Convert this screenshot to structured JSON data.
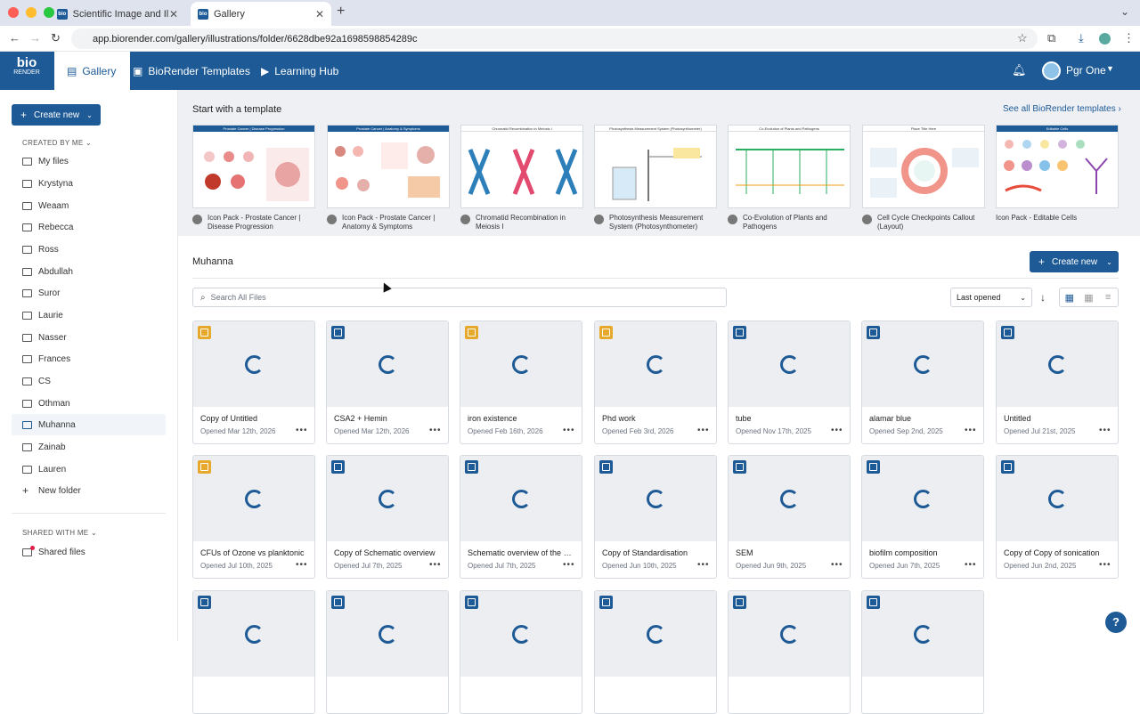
{
  "browser": {
    "tabs": [
      {
        "label": "Scientific Image and Illustrati"
      },
      {
        "label": "Gallery"
      }
    ],
    "url": "app.biorender.com/gallery/illustrations/folder/6628dbe92a1698598854289c"
  },
  "topnav": {
    "logo_top": "bio",
    "logo_bottom": "RENDER",
    "items": [
      {
        "label": "Gallery"
      },
      {
        "label": "BioRender Templates"
      },
      {
        "label": "Learning Hub"
      }
    ],
    "user": "Pgr One"
  },
  "sidebar": {
    "create_label": "Create new",
    "created_section": "CREATED BY ME",
    "items": [
      {
        "label": "My files"
      },
      {
        "label": "Krystyna"
      },
      {
        "label": "Weaam"
      },
      {
        "label": "Rebecca"
      },
      {
        "label": "Ross"
      },
      {
        "label": "Abdullah"
      },
      {
        "label": "Suror"
      },
      {
        "label": "Laurie"
      },
      {
        "label": "Nasser"
      },
      {
        "label": "Frances"
      },
      {
        "label": "CS"
      },
      {
        "label": "Othman"
      },
      {
        "label": "Muhanna"
      },
      {
        "label": "Zainab"
      },
      {
        "label": "Lauren"
      }
    ],
    "new_folder": "New folder",
    "shared_section": "SHARED WITH ME",
    "shared_files": "Shared files"
  },
  "templates": {
    "heading": "Start with a template",
    "see_all": "See all BioRender templates",
    "items": [
      {
        "caption": "Icon Pack - Prostate Cancer | Disease Progression",
        "thumb_title": "Prostate Cancer | Disease Progression"
      },
      {
        "caption": "Icon Pack - Prostate Cancer | Anatomy & Symptoms",
        "thumb_title": "Prostate Cancer | Anatomy & Symptoms"
      },
      {
        "caption": "Chromatid Recombination in Meiosis I",
        "thumb_title": "Chromatid Recombination in Meiosis I"
      },
      {
        "caption": "Photosynthesis Measurement System (Photosynthometer)",
        "thumb_title": "Photosynthesis Measurement System (Photosynthometer)"
      },
      {
        "caption": "Co-Evolution of Plants and Pathogens",
        "thumb_title": "Co-Evolution of Plants and Pathogens"
      },
      {
        "caption": "Cell Cycle Checkpoints Callout (Layout)",
        "thumb_title": "Place Title Here"
      },
      {
        "caption": "Icon Pack - Editable Cells",
        "thumb_title": "Editable Cells"
      }
    ]
  },
  "folder": {
    "title": "Muhanna",
    "create_label": "Create new",
    "search_placeholder": "Search All Files",
    "sort": "Last opened",
    "colors": {
      "brand": "#1d5a96",
      "badge_blue": "#1d5a96",
      "badge_orange": "#e7a92b"
    },
    "files": [
      {
        "title": "Copy of Untitled",
        "opened": "Opened Mar 12th, 2026",
        "badge": "orange"
      },
      {
        "title": "CSA2 + Hemin",
        "opened": "Opened Mar 12th, 2026",
        "badge": "blue"
      },
      {
        "title": "iron existence",
        "opened": "Opened Feb 16th, 2026",
        "badge": "orange"
      },
      {
        "title": "Phd work",
        "opened": "Opened Feb 3rd, 2026",
        "badge": "orange"
      },
      {
        "title": "tube",
        "opened": "Opened Nov 17th, 2025",
        "badge": "blue"
      },
      {
        "title": "alamar blue",
        "opened": "Opened Sep 2nd, 2025",
        "badge": "blue"
      },
      {
        "title": "Untitled",
        "opened": "Opened Jul 21st, 2025",
        "badge": "blue"
      },
      {
        "title": "CFUs of Ozone vs planktonic",
        "opened": "Opened Jul 10th, 2025",
        "badge": "orange"
      },
      {
        "title": "Copy of Schematic overview",
        "opened": "Opened Jul 7th, 2025",
        "badge": "blue"
      },
      {
        "title": "Schematic overview of the biofilm",
        "opened": "Opened Jul 7th, 2025",
        "badge": "blue"
      },
      {
        "title": "Copy of Standardisation",
        "opened": "Opened Jun 10th, 2025",
        "badge": "blue"
      },
      {
        "title": "SEM",
        "opened": "Opened Jun 9th, 2025",
        "badge": "blue"
      },
      {
        "title": "biofilm composition",
        "opened": "Opened Jun 7th, 2025",
        "badge": "blue"
      },
      {
        "title": "Copy of Copy of sonication",
        "opened": "Opened Jun 2nd, 2025",
        "badge": "blue"
      },
      {
        "title": "",
        "opened": "",
        "badge": "blue"
      },
      {
        "title": "",
        "opened": "",
        "badge": "blue"
      },
      {
        "title": "",
        "opened": "",
        "badge": "blue"
      },
      {
        "title": "",
        "opened": "",
        "badge": "blue"
      },
      {
        "title": "",
        "opened": "",
        "badge": "blue"
      },
      {
        "title": "",
        "opened": "",
        "badge": "blue"
      }
    ]
  },
  "help_label": "?"
}
